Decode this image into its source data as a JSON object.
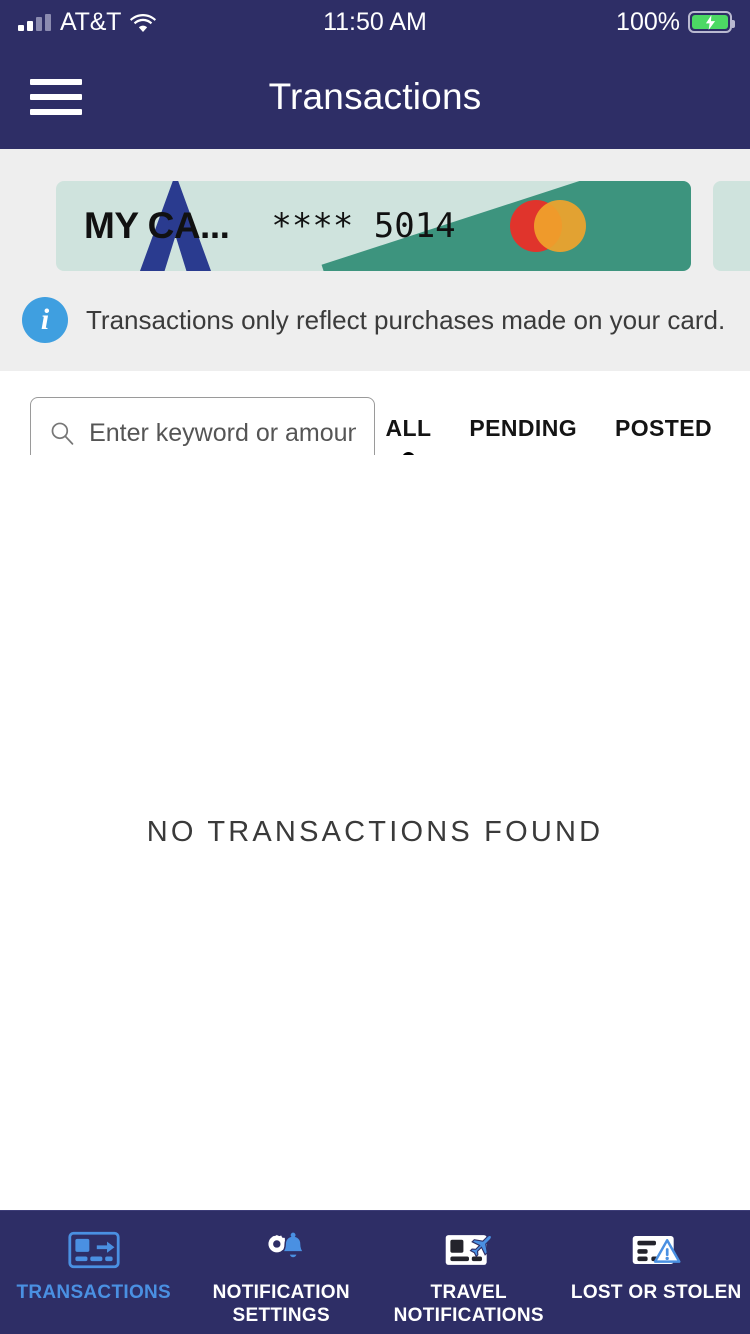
{
  "status_bar": {
    "carrier": "AT&T",
    "time": "11:50 AM",
    "battery_percent": "100%",
    "signal_icon": "signal-bars-icon",
    "wifi_icon": "wifi-icon",
    "battery_icon": "battery-charging-icon"
  },
  "header": {
    "title": "Transactions",
    "menu_icon": "hamburger-menu-icon"
  },
  "cards": [
    {
      "name": "MY CA...",
      "masked_number": "**** 5014",
      "network": "mastercard-logo",
      "background_color": "#cfe3dd",
      "stripe_color": "#3d947e",
      "logo_color": "#2a3b8f"
    },
    {
      "name": "",
      "masked_number": "",
      "network": "",
      "background_color": "#cfe3dd",
      "stripe_color": "",
      "logo_color": ""
    }
  ],
  "info_banner": {
    "icon": "info-circle-icon",
    "text": "Transactions only reflect purchases made on your card."
  },
  "search": {
    "placeholder": "Enter keyword or amount",
    "value": "",
    "icon": "search-icon"
  },
  "filters": {
    "tabs": [
      {
        "label": "ALL",
        "active": true
      },
      {
        "label": "PENDING",
        "active": false
      },
      {
        "label": "POSTED",
        "active": false
      }
    ]
  },
  "empty_state": {
    "message": "NO TRANSACTIONS FOUND"
  },
  "bottom_nav": {
    "items": [
      {
        "label": "TRANSACTIONS",
        "icon": "card-arrow-icon",
        "active": true
      },
      {
        "label": "NOTIFICATION\nSETTINGS",
        "line1": "NOTIFICATION",
        "line2": "SETTINGS",
        "icon": "gear-bell-icon",
        "active": false
      },
      {
        "label": "TRAVEL\nNOTIFICATIONS",
        "line1": "TRAVEL",
        "line2": "NOTIFICATIONS",
        "icon": "card-airplane-icon",
        "active": false
      },
      {
        "label": "LOST OR STOLEN",
        "line1": "LOST OR STOLEN",
        "line2": "",
        "icon": "card-warning-icon",
        "active": false
      }
    ]
  },
  "colors": {
    "header_navy": "#2e2e66",
    "accent_blue": "#4a90e2",
    "banner_gray": "#eeeeee",
    "card_mint": "#cfe3dd",
    "card_green": "#3d947e",
    "mastercard_red": "#e0342c",
    "mastercard_orange": "#f0a32b"
  }
}
